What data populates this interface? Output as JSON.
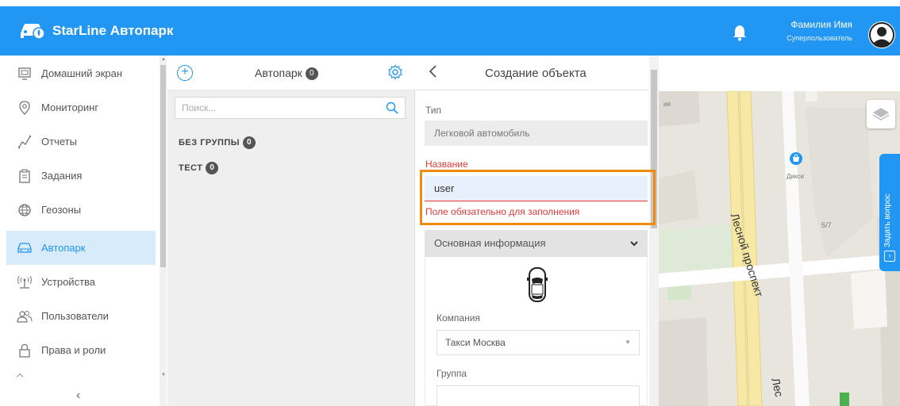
{
  "app": {
    "title": "StarLine Автопарк"
  },
  "user": {
    "name": "Фамилия Имя",
    "role": "Суперпользователь"
  },
  "sidebar": {
    "items": [
      {
        "label": "Домашний экран",
        "icon": "home-screen-icon",
        "active": false
      },
      {
        "label": "Мониторинг",
        "icon": "location-pin-icon",
        "active": false
      },
      {
        "label": "Отчеты",
        "icon": "chart-line-icon",
        "active": false
      },
      {
        "label": "Задания",
        "icon": "clipboard-icon",
        "active": false
      },
      {
        "label": "Геозоны",
        "icon": "globe-icon",
        "active": false
      },
      {
        "label": "Автопарк",
        "icon": "car-icon",
        "active": true
      },
      {
        "label": "Устройства",
        "icon": "antenna-icon",
        "active": false
      },
      {
        "label": "Пользователи",
        "icon": "users-icon",
        "active": false
      },
      {
        "label": "Права и роли",
        "icon": "lock-icon",
        "active": false
      }
    ],
    "collapse_glyph": "‹"
  },
  "fleet": {
    "title": "Автопарк",
    "count": "0",
    "search_placeholder": "Поиск...",
    "groups": [
      {
        "label": "БЕЗ ГРУППЫ",
        "count": "0"
      },
      {
        "label": "ТЕСТ",
        "count": "0"
      }
    ]
  },
  "create": {
    "title": "Создание объекта",
    "type_label": "Тип",
    "type_value": "Легковой автомобиль",
    "name_label": "Название",
    "name_value": "user",
    "name_error": "Поле обязательно для заполнения",
    "section_title": "Основная информация",
    "company_label": "Компания",
    "company_value": "Такси Москва",
    "group_label": "Группа"
  },
  "map": {
    "street_1": "Лесной проспект",
    "street_2": "Лес",
    "poi_name": "Дикси",
    "building_number": "5/7",
    "partial_label": "ия",
    "ask_question": "Задать вопрос"
  },
  "colors": {
    "primary": "#2196f3",
    "active_bg": "#d8ebfb",
    "error": "#e53935",
    "highlight": "#f08a10"
  }
}
